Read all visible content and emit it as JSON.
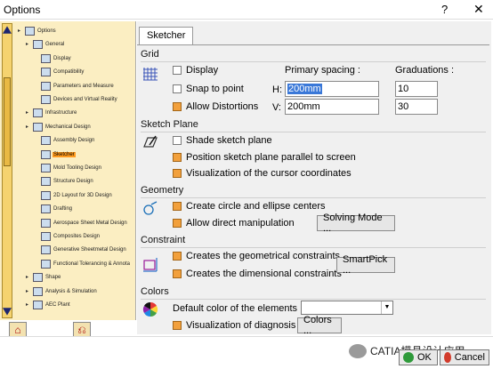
{
  "window": {
    "title": "Options",
    "help_glyph": "?",
    "close_glyph": "✕"
  },
  "tree": {
    "items": [
      {
        "label": "Options",
        "level": 0,
        "selected": false
      },
      {
        "label": "General",
        "level": 1,
        "selected": false
      },
      {
        "label": "Display",
        "level": 2,
        "selected": false
      },
      {
        "label": "Compatibility",
        "level": 2,
        "selected": false
      },
      {
        "label": "Parameters and Measure",
        "level": 2,
        "selected": false
      },
      {
        "label": "Devices and Virtual Reality",
        "level": 2,
        "selected": false
      },
      {
        "label": "Infrastructure",
        "level": 1,
        "selected": false
      },
      {
        "label": "Mechanical Design",
        "level": 1,
        "selected": false
      },
      {
        "label": "Assembly Design",
        "level": 2,
        "selected": false
      },
      {
        "label": "Sketcher",
        "level": 2,
        "selected": true
      },
      {
        "label": "Mold Tooling Design",
        "level": 2,
        "selected": false
      },
      {
        "label": "Structure Design",
        "level": 2,
        "selected": false
      },
      {
        "label": "2D Layout for 3D Design",
        "level": 2,
        "selected": false
      },
      {
        "label": "Drafting",
        "level": 2,
        "selected": false
      },
      {
        "label": "Aerospace Sheet Metal Design",
        "level": 2,
        "selected": false
      },
      {
        "label": "Composites Design",
        "level": 2,
        "selected": false
      },
      {
        "label": "Generative Sheetmetal Design",
        "level": 2,
        "selected": false
      },
      {
        "label": "Functional Tolerancing & Annota",
        "level": 2,
        "selected": false
      },
      {
        "label": "Shape",
        "level": 1,
        "selected": false
      },
      {
        "label": "Analysis & Simulation",
        "level": 1,
        "selected": false
      },
      {
        "label": "AEC Plant",
        "level": 1,
        "selected": false
      }
    ]
  },
  "tab": {
    "label": "Sketcher"
  },
  "grid": {
    "section": "Grid",
    "display_label": "Display",
    "snap_label": "Snap to point",
    "distortions_label": "Allow Distortions",
    "primary_spacing_label": "Primary spacing :",
    "graduations_label": "Graduations :",
    "h_label": "H:",
    "v_label": "V:",
    "h_value": "200mm",
    "v_value": "200mm",
    "h_grad": "10",
    "v_grad": "30"
  },
  "sketch_plane": {
    "section": "Sketch Plane",
    "shade_label": "Shade sketch plane",
    "position_label": "Position sketch plane parallel to screen",
    "visualization_label": "Visualization of the cursor coordinates"
  },
  "geometry": {
    "section": "Geometry",
    "create_label": "Create circle and ellipse centers",
    "allow_label": "Allow direct manipulation",
    "solving_button": "Solving Mode ..."
  },
  "constraint": {
    "section": "Constraint",
    "geometrical_label": "Creates the geometrical constraints",
    "dimensional_label": "Creates the dimensional constraints",
    "smartpick_button": "SmartPick ..."
  },
  "colors": {
    "section": "Colors",
    "default_color_label": "Default color of the elements",
    "diagnosis_label": "Visualization of diagnosis",
    "colors_button": "Colors ..."
  },
  "footer": {
    "brand": "CATIA模具设计应用",
    "ok_label": "OK",
    "cancel_label": "Cancel"
  },
  "accent_colors": {
    "selected": "#ff9a1e",
    "checked": "#f2a03c",
    "tree_bg": "#fbeec2"
  }
}
